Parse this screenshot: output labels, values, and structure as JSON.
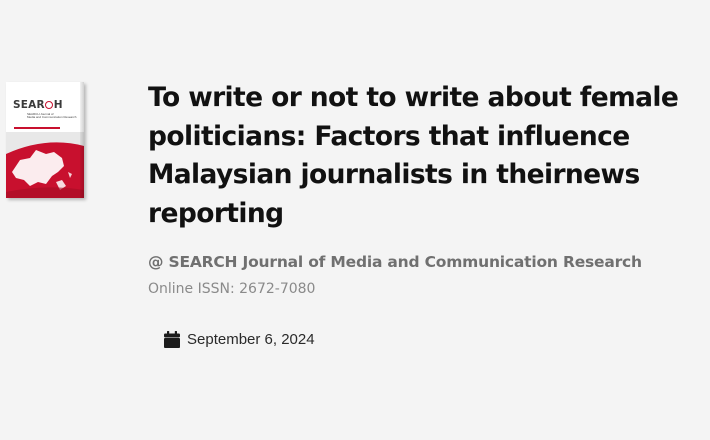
{
  "cover": {
    "brand": "SEARCH",
    "subtitle": "SEARCH Journal of Media and Communication Research",
    "accent_color": "#c8102e"
  },
  "article": {
    "title": "To write or not to write about female politicians: Factors that influence Malaysian journalists in theirnews reporting",
    "journal": "@ SEARCH Journal of Media and Communication Research",
    "issn": "Online ISSN: 2672-7080",
    "date": "September 6, 2024",
    "date_icon": "calendar-icon"
  }
}
